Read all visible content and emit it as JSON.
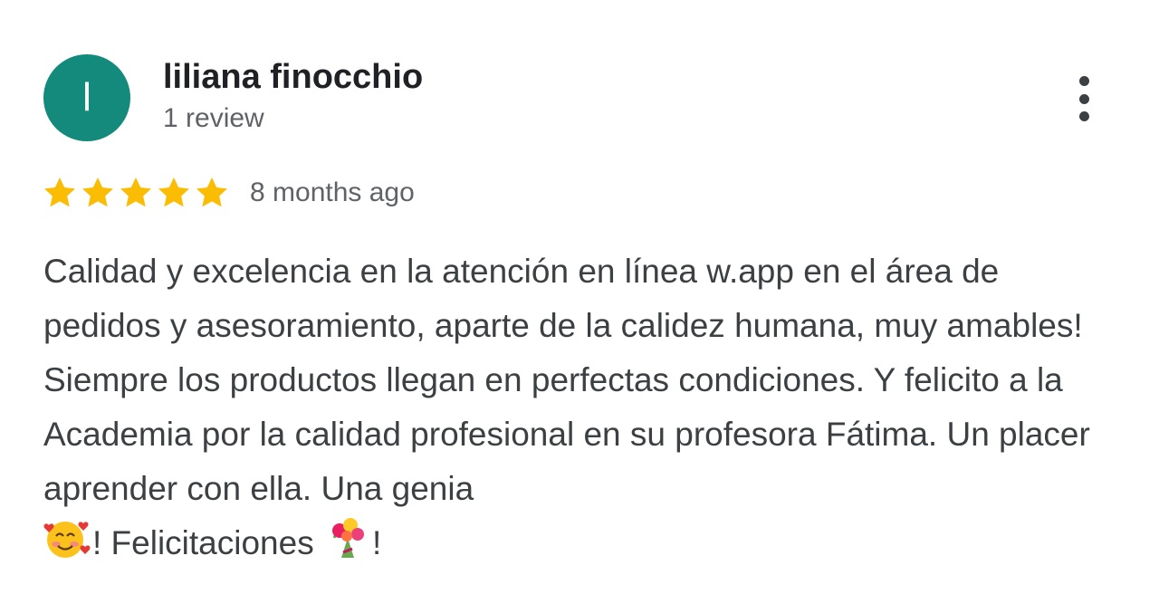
{
  "reviewer": {
    "initial": "l",
    "name": "liliana finocchio",
    "review_count": "1 review",
    "avatar_color": "#138a7c"
  },
  "menu": {
    "icon": "more-vert-icon"
  },
  "rating": {
    "stars": 5,
    "max_stars": 5,
    "star_color": "#fbbc04",
    "date": "8 months ago"
  },
  "review": {
    "text_before_emoji_1": "Calidad y excelencia en la atención en línea w.app en el área de pedidos y asesoramiento, aparte de la calidez humana, muy amables! Siempre los productos llegan en perfectas condiciones. Y felicito a la Academia por la calidad profesional en su profesora Fátima. Un placer aprender con ella. Una genia",
    "emoji_1": "smiling-face-with-hearts-icon",
    "text_between_emojis": "! Felicitaciones ",
    "emoji_2": "bouquet-icon",
    "text_after_emoji_2": "!"
  }
}
